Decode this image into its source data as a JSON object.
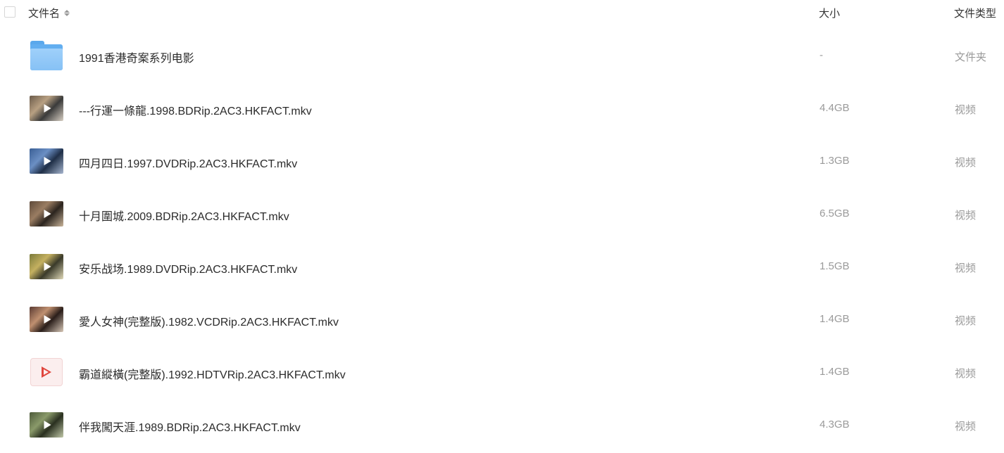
{
  "header": {
    "name_label": "文件名",
    "size_label": "大小",
    "type_label": "文件类型"
  },
  "rows": [
    {
      "name": "1991香港奇案系列电影",
      "size": "-",
      "type": "文件夹",
      "icon": "folder-icon"
    },
    {
      "name": "---行運一條龍.1998.BDRip.2AC3.HKFACT.mkv",
      "size": "4.4GB",
      "type": "视频",
      "icon": "video-thumbnail",
      "colors": [
        "#6a5a4a",
        "#b8a082",
        "#3a3a3a",
        "#d8d0c4"
      ]
    },
    {
      "name": "四月四日.1997.DVDRip.2AC3.HKFACT.mkv",
      "size": "1.3GB",
      "type": "视频",
      "icon": "video-thumbnail",
      "colors": [
        "#3a5f95",
        "#6b8fc4",
        "#1f2f48",
        "#a7b6cf"
      ]
    },
    {
      "name": "十月圍城.2009.BDRip.2AC3.HKFACT.mkv",
      "size": "6.5GB",
      "type": "视频",
      "icon": "video-thumbnail",
      "colors": [
        "#5e4a3a",
        "#9a7d62",
        "#2b241e",
        "#c9b49a"
      ]
    },
    {
      "name": "安乐战场.1989.DVDRip.2AC3.HKFACT.mkv",
      "size": "1.5GB",
      "type": "视频",
      "icon": "video-thumbnail",
      "colors": [
        "#7a7a3a",
        "#c4b060",
        "#3a3a2a",
        "#e0d9b8"
      ]
    },
    {
      "name": "愛人女神(完整版).1982.VCDRip.2AC3.HKFACT.mkv",
      "size": "1.4GB",
      "type": "视频",
      "icon": "video-thumbnail",
      "colors": [
        "#5a3a32",
        "#c09070",
        "#2a1e1a",
        "#d8c8b8"
      ]
    },
    {
      "name": "霸道縱橫(完整版).1992.HDTVRip.2AC3.HKFACT.mkv",
      "size": "1.4GB",
      "type": "视频",
      "icon": "video-generic-icon"
    },
    {
      "name": "伴我闖天涯.1989.BDRip.2AC3.HKFACT.mkv",
      "size": "4.3GB",
      "type": "视频",
      "icon": "video-thumbnail",
      "colors": [
        "#4d5a3a",
        "#8a9a6a",
        "#2a3020",
        "#c0c8a8"
      ]
    }
  ]
}
